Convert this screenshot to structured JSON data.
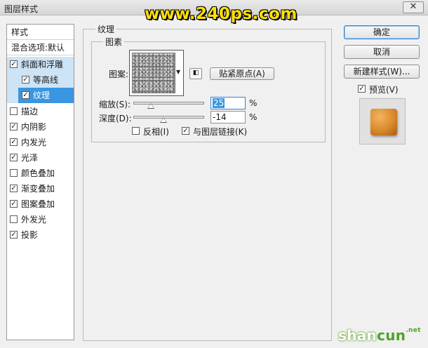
{
  "window": {
    "title": "图层样式",
    "close_glyph": "✕"
  },
  "watermark": "www.240ps.com",
  "left_panel": {
    "header": "样式",
    "blend_options": "混合选项:默认",
    "items": [
      {
        "label": "斜面和浮雕",
        "checked": true
      },
      {
        "label": "等高线",
        "checked": true
      },
      {
        "label": "纹理",
        "checked": true
      },
      {
        "label": "描边",
        "checked": false
      },
      {
        "label": "内阴影",
        "checked": true
      },
      {
        "label": "内发光",
        "checked": true
      },
      {
        "label": "光泽",
        "checked": true
      },
      {
        "label": "颜色叠加",
        "checked": false
      },
      {
        "label": "渐变叠加",
        "checked": true
      },
      {
        "label": "图案叠加",
        "checked": true
      },
      {
        "label": "外发光",
        "checked": false
      },
      {
        "label": "投影",
        "checked": true
      }
    ]
  },
  "texture": {
    "group_title": "纹理",
    "element_title": "图素",
    "pattern_label": "图案:",
    "snap_button": "贴紧原点(A)",
    "scale_label": "缩放(S):",
    "scale_value": "25",
    "scale_fraction": 0.25,
    "depth_label": "深度(D):",
    "depth_value": "-14",
    "depth_fraction": 0.43,
    "percent": "%",
    "invert_label": "反相(I)",
    "invert_checked": false,
    "link_label": "与图层链接(K)",
    "link_checked": true
  },
  "right": {
    "ok": "确定",
    "cancel": "取消",
    "new_style": "新建样式(W)...",
    "preview_label": "预览(V)",
    "preview_checked": true
  },
  "footer_logo": {
    "main": "shan",
    "accent": "cun",
    "suffix": ".net"
  },
  "colors": {
    "selection_dark": "#3a96e0",
    "selection_light": "#cde4f7",
    "watermark": "#ffe100"
  }
}
